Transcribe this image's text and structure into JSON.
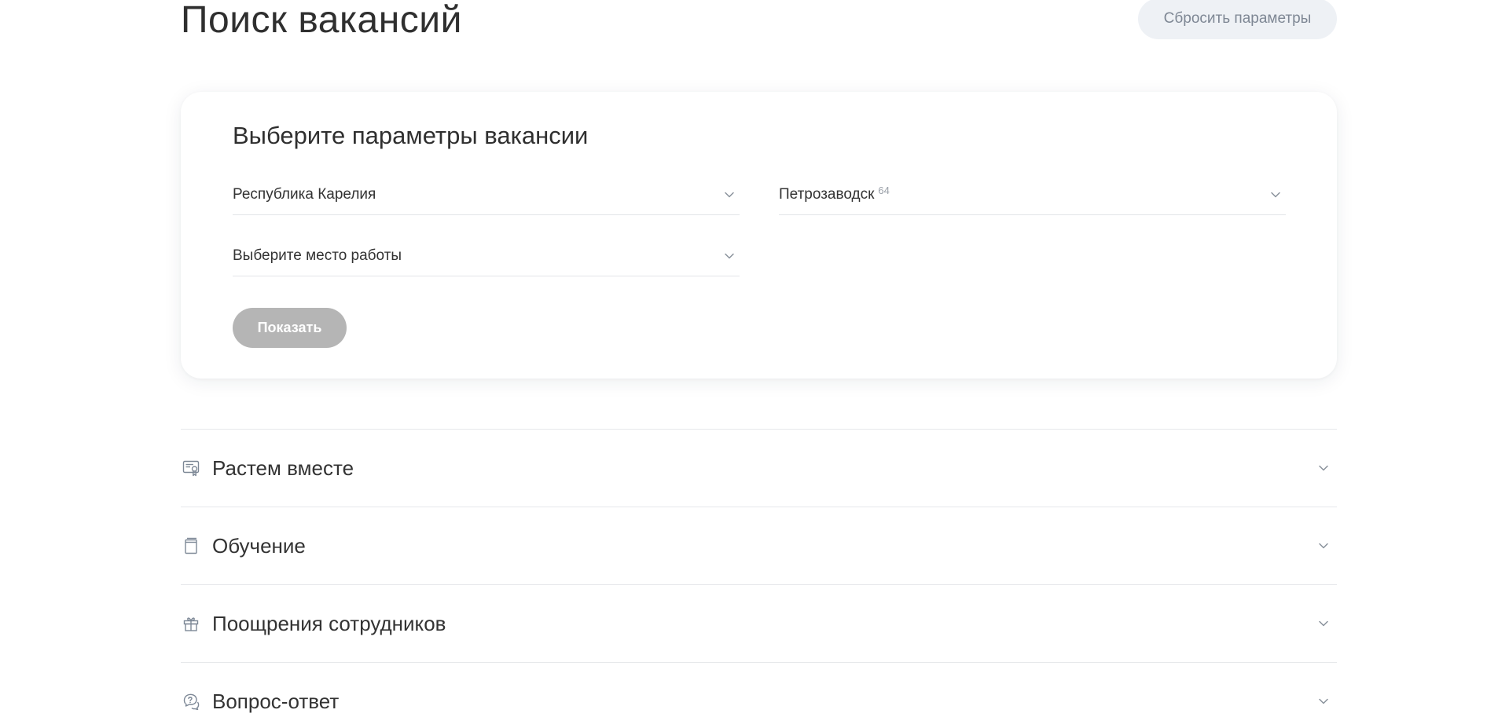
{
  "header": {
    "title": "Поиск вакансий",
    "reset_label": "Сбросить параметры"
  },
  "filters": {
    "title": "Выберите параметры вакансии",
    "region": {
      "value": "Республика Карелия"
    },
    "city": {
      "value": "Петрозаводск",
      "count": "64"
    },
    "workplace": {
      "placeholder": "Выберите место работы"
    },
    "show_label": "Показать"
  },
  "accordion": {
    "items": [
      {
        "label": "Растем вместе",
        "icon": "certificate-icon"
      },
      {
        "label": "Обучение",
        "icon": "book-icon"
      },
      {
        "label": "Поощрения сотрудников",
        "icon": "gift-icon"
      },
      {
        "label": "Вопрос-ответ",
        "icon": "chat-question-icon"
      }
    ]
  },
  "colors": {
    "icon": "#7d8896",
    "chevron": "#8a929c",
    "button_disabled": "#b5b5b5",
    "reset_bg": "#eef1f5"
  }
}
